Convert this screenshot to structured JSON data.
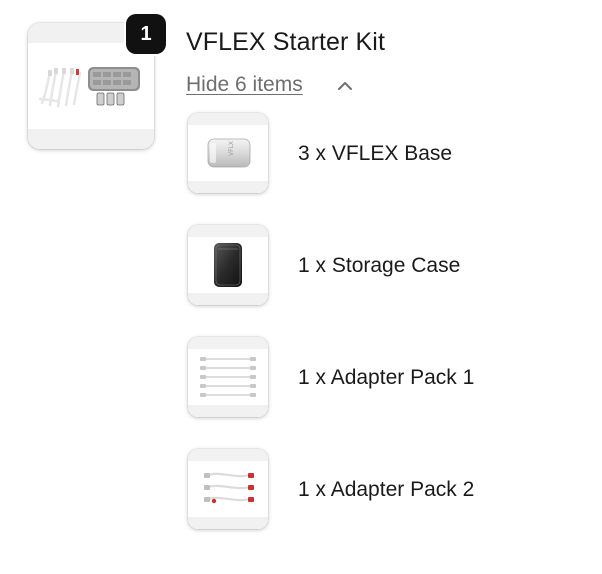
{
  "product": {
    "title": "VFLEX Starter Kit",
    "quantity": "1",
    "toggle_label": "Hide 6 items",
    "toggle_icon": "chevron-up-icon",
    "image_icon": "starter-kit-image"
  },
  "items": [
    {
      "label": "3 x VFLEX Base",
      "image_icon": "vflex-base-image"
    },
    {
      "label": "1 x Storage Case",
      "image_icon": "storage-case-image"
    },
    {
      "label": "1 x Adapter Pack 1",
      "image_icon": "adapter-pack-1-image"
    },
    {
      "label": "1 x Adapter Pack 2",
      "image_icon": "adapter-pack-2-image"
    }
  ],
  "colors": {
    "badge_bg": "#111111",
    "badge_text": "#ffffff",
    "toggle_text": "#6e6e6e",
    "title_text": "#1a1a1a"
  }
}
